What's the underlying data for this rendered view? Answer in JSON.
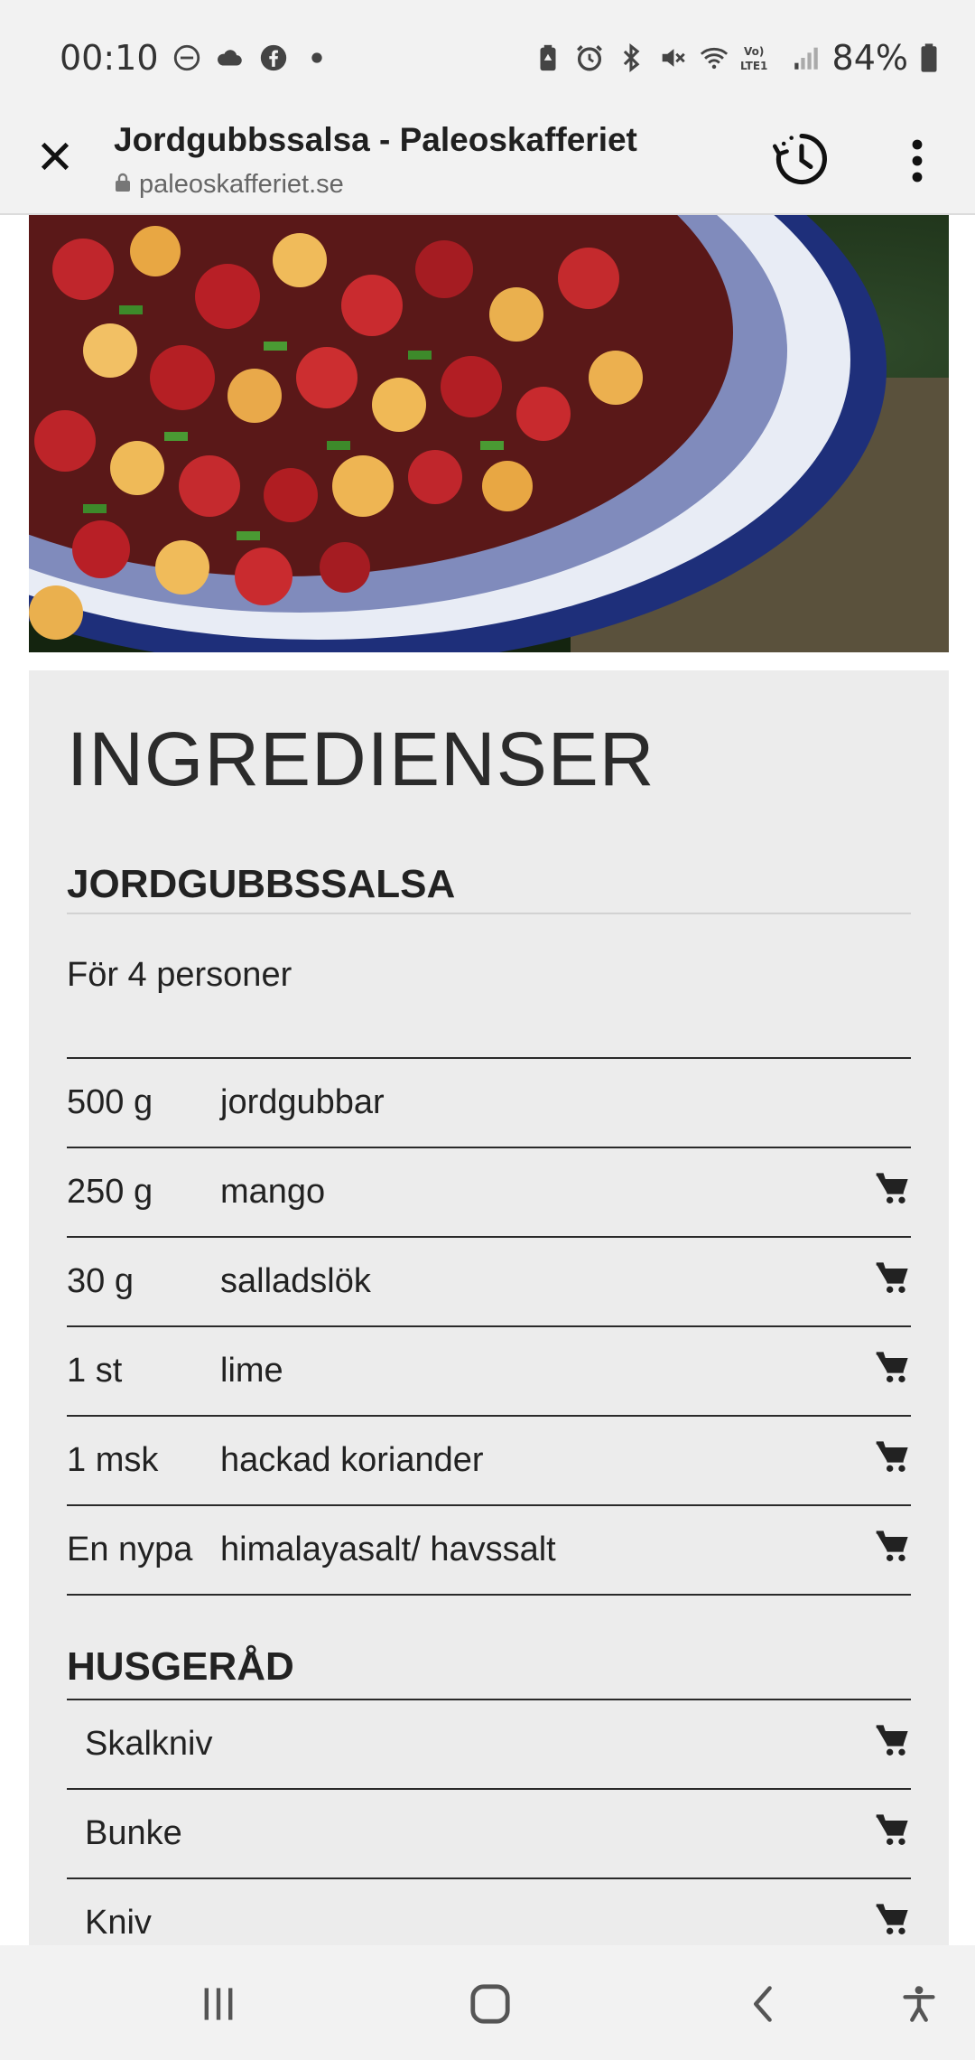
{
  "status_bar": {
    "time": "00:10",
    "battery": "84%",
    "network_label": "Vo) LTE1"
  },
  "toolbar": {
    "title": "Jordgubbssalsa - Paleoskafferiet",
    "url": "paleoskafferiet.se"
  },
  "recipe": {
    "section_title": "INGREDIENSER",
    "group_title": "JORDGUBBSSALSA",
    "servings": "För 4 personer",
    "ingredients": [
      {
        "amount": "500 g",
        "name": "jordgubbar",
        "cart": false
      },
      {
        "amount": "250 g",
        "name": "mango",
        "cart": true
      },
      {
        "amount": "30 g",
        "name": "salladslök",
        "cart": true
      },
      {
        "amount": "1 st",
        "name": "lime",
        "cart": true
      },
      {
        "amount": "1 msk",
        "name": "hackad koriander",
        "cart": true
      },
      {
        "amount": "En nypa",
        "name": "himalayasalt/ havssalt",
        "cart": true
      }
    ],
    "tools_title": "HUSGERÅD",
    "tools": [
      {
        "name": "Skalkniv"
      },
      {
        "name": "Bunke"
      },
      {
        "name": "Kniv"
      }
    ]
  },
  "icons": {
    "close": "close-icon",
    "lock": "lock-icon",
    "history": "history-icon",
    "menu": "more-vert-icon",
    "cart": "cart-icon"
  }
}
